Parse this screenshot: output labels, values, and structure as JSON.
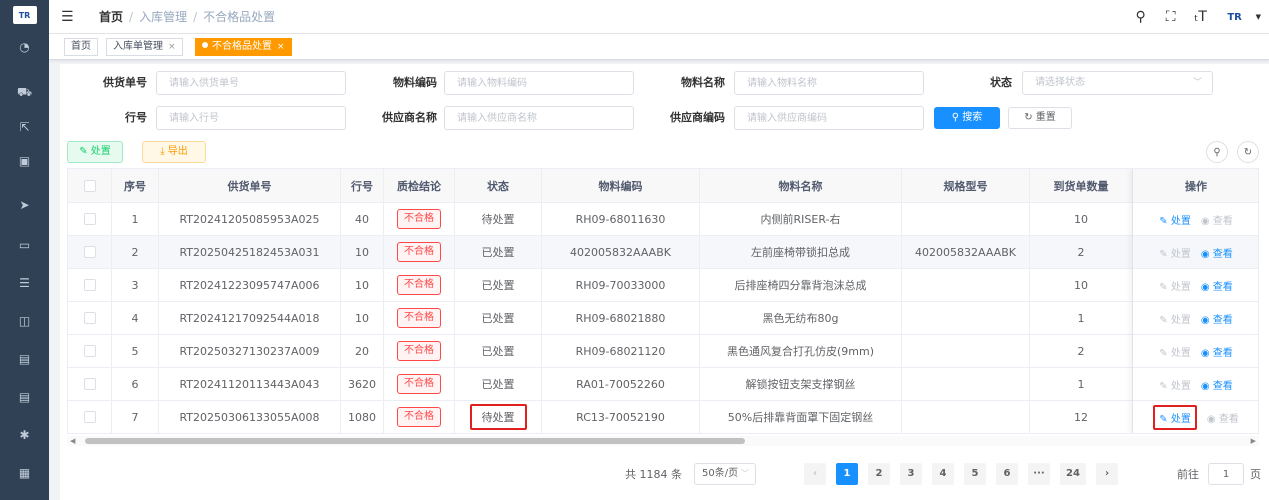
{
  "logo_text": "TR",
  "header": {
    "breadcrumb": [
      "首页",
      "入库管理",
      "不合格品处置"
    ]
  },
  "tags": [
    {
      "label": "首页"
    },
    {
      "label": "入库单管理"
    },
    {
      "label": "不合格品处置"
    }
  ],
  "filters": {
    "supply_no": {
      "label": "供货单号",
      "placeholder": "请输入供货单号"
    },
    "material_code": {
      "label": "物料编码",
      "placeholder": "请输入物料编码"
    },
    "material_name": {
      "label": "物料名称",
      "placeholder": "请输入物料名称"
    },
    "status": {
      "label": "状态",
      "placeholder": "请选择状态"
    },
    "line_no": {
      "label": "行号",
      "placeholder": "请输入行号"
    },
    "supplier_name": {
      "label": "供应商名称",
      "placeholder": "请输入供应商名称"
    },
    "supplier_code": {
      "label": "供应商编码",
      "placeholder": "请输入供应商编码"
    },
    "search_label": "搜索",
    "reset_label": "重置"
  },
  "toolbar": {
    "handle_label": "处置",
    "export_label": "导出"
  },
  "table": {
    "columns": [
      "序号",
      "供货单号",
      "行号",
      "质检结论",
      "状态",
      "物料编码",
      "物料名称",
      "规格型号",
      "到货单数量",
      "操作"
    ],
    "rows": [
      {
        "idx": "1",
        "supply_no": "RT20241205085953A025",
        "line": "40",
        "qc": "不合格",
        "status": "待处置",
        "code": "RH09-68011630",
        "name": "内侧前RISER-右",
        "spec": "",
        "qty": "10",
        "handle": "处置",
        "view": "查看"
      },
      {
        "idx": "2",
        "supply_no": "RT20250425182453A031",
        "line": "10",
        "qc": "不合格",
        "status": "已处置",
        "code": "402005832AAABK",
        "name": "左前座椅带锁扣总成",
        "spec": "402005832AAABK",
        "qty": "2",
        "handle": "处置",
        "view": "查看"
      },
      {
        "idx": "3",
        "supply_no": "RT20241223095747A006",
        "line": "10",
        "qc": "不合格",
        "status": "已处置",
        "code": "RH09-70033000",
        "name": "后排座椅四分靠背泡沫总成",
        "spec": "",
        "qty": "10",
        "handle": "处置",
        "view": "查看"
      },
      {
        "idx": "4",
        "supply_no": "RT20241217092544A018",
        "line": "10",
        "qc": "不合格",
        "status": "已处置",
        "code": "RH09-68021880",
        "name": "黑色无纺布80g",
        "spec": "",
        "qty": "1",
        "handle": "处置",
        "view": "查看"
      },
      {
        "idx": "5",
        "supply_no": "RT20250327130237A009",
        "line": "20",
        "qc": "不合格",
        "status": "已处置",
        "code": "RH09-68021120",
        "name": "黑色通风复合打孔仿皮(9mm)",
        "spec": "",
        "qty": "2",
        "handle": "处置",
        "view": "查看"
      },
      {
        "idx": "6",
        "supply_no": "RT20241120113443A043",
        "line": "3620",
        "qc": "不合格",
        "status": "已处置",
        "code": "RA01-70052260",
        "name": "解锁按钮支架支撑钢丝",
        "spec": "",
        "qty": "1",
        "handle": "处置",
        "view": "查看"
      },
      {
        "idx": "7",
        "supply_no": "RT20250306133055A008",
        "line": "1080",
        "qc": "不合格",
        "status": "待处置",
        "code": "RC13-70052190",
        "name": "50%后排靠背面罩下固定钢丝",
        "spec": "",
        "qty": "12",
        "handle": "处置",
        "view": "查看"
      }
    ]
  },
  "pagination": {
    "total": "共 1184 条",
    "page_size": "50条/页",
    "pages": [
      "1",
      "2",
      "3",
      "4",
      "5",
      "6",
      "···",
      "24"
    ],
    "goto_label": "前往",
    "goto_value": "1",
    "unit": "页"
  },
  "colors": {
    "sidebar": "#304156",
    "primary": "#1890ff",
    "warning": "#ff9900",
    "danger": "#ff4949",
    "highlight": "#e02020"
  }
}
